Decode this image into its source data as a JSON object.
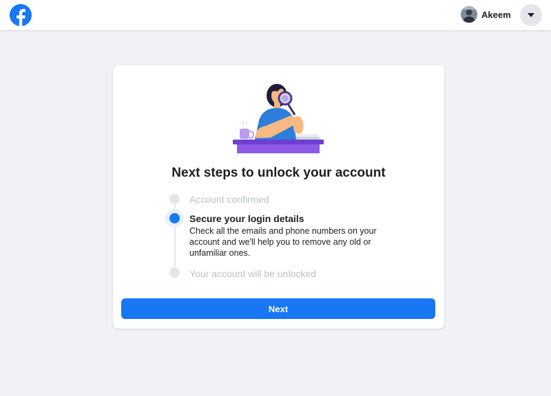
{
  "header": {
    "logo_icon": "facebook-logo-icon",
    "brand_color": "#1877f2",
    "profile_name": "Akeem",
    "menu_icon": "caret-down-icon"
  },
  "main": {
    "illustration": "woman-magnifying-glass-illustration",
    "title": "Next steps to unlock your account",
    "steps": [
      {
        "label": "Account confirmed",
        "state": "completed"
      },
      {
        "label": "Secure your login details",
        "state": "current",
        "description": "Check all the emails and phone numbers on your account and we'll help you to remove any old or unfamiliar ones."
      },
      {
        "label": "Your account will be unlocked",
        "state": "upcoming"
      }
    ],
    "next_label": "Next"
  }
}
